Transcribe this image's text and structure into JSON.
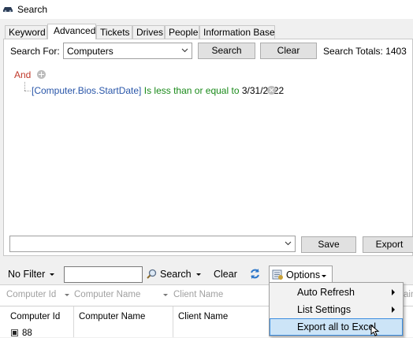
{
  "window": {
    "title": "Search"
  },
  "tabs": [
    {
      "label": "Keyword"
    },
    {
      "label": "Advanced"
    },
    {
      "label": "Tickets"
    },
    {
      "label": "Drives"
    },
    {
      "label": "People"
    },
    {
      "label": "Information Base"
    }
  ],
  "search": {
    "search_for_label": "Search For:",
    "search_for_value": "Computers",
    "search_button": "Search",
    "clear_button": "Clear",
    "totals": "Search Totals: 1403"
  },
  "criteria": {
    "group_op": "And",
    "condition": {
      "field": "[Computer.Bios.StartDate]",
      "operator": "Is less than or equal to",
      "value": "3/31/2022"
    }
  },
  "save_bar": {
    "save_button": "Save",
    "export_button": "Export"
  },
  "results_toolbar": {
    "no_filter": "No Filter",
    "search_label": "Search",
    "clear_label": "Clear",
    "options_label": "Options"
  },
  "column_filters": [
    "Computer Id",
    "Computer Name",
    "Client Name",
    "ain"
  ],
  "grid": {
    "headers": [
      "Computer Id",
      "Computer Name",
      "Client Name"
    ],
    "first_row_id": "88"
  },
  "options_menu": {
    "items": [
      {
        "label": "Auto Refresh",
        "submenu": true
      },
      {
        "label": "List Settings",
        "submenu": true
      },
      {
        "label": "Export all to Excel",
        "submenu": false
      }
    ]
  },
  "colors": {
    "and_red": "#c0392b",
    "field_blue": "#2855a8",
    "operator_green": "#1a8a1a",
    "menu_highlight": "#cce4f7"
  }
}
